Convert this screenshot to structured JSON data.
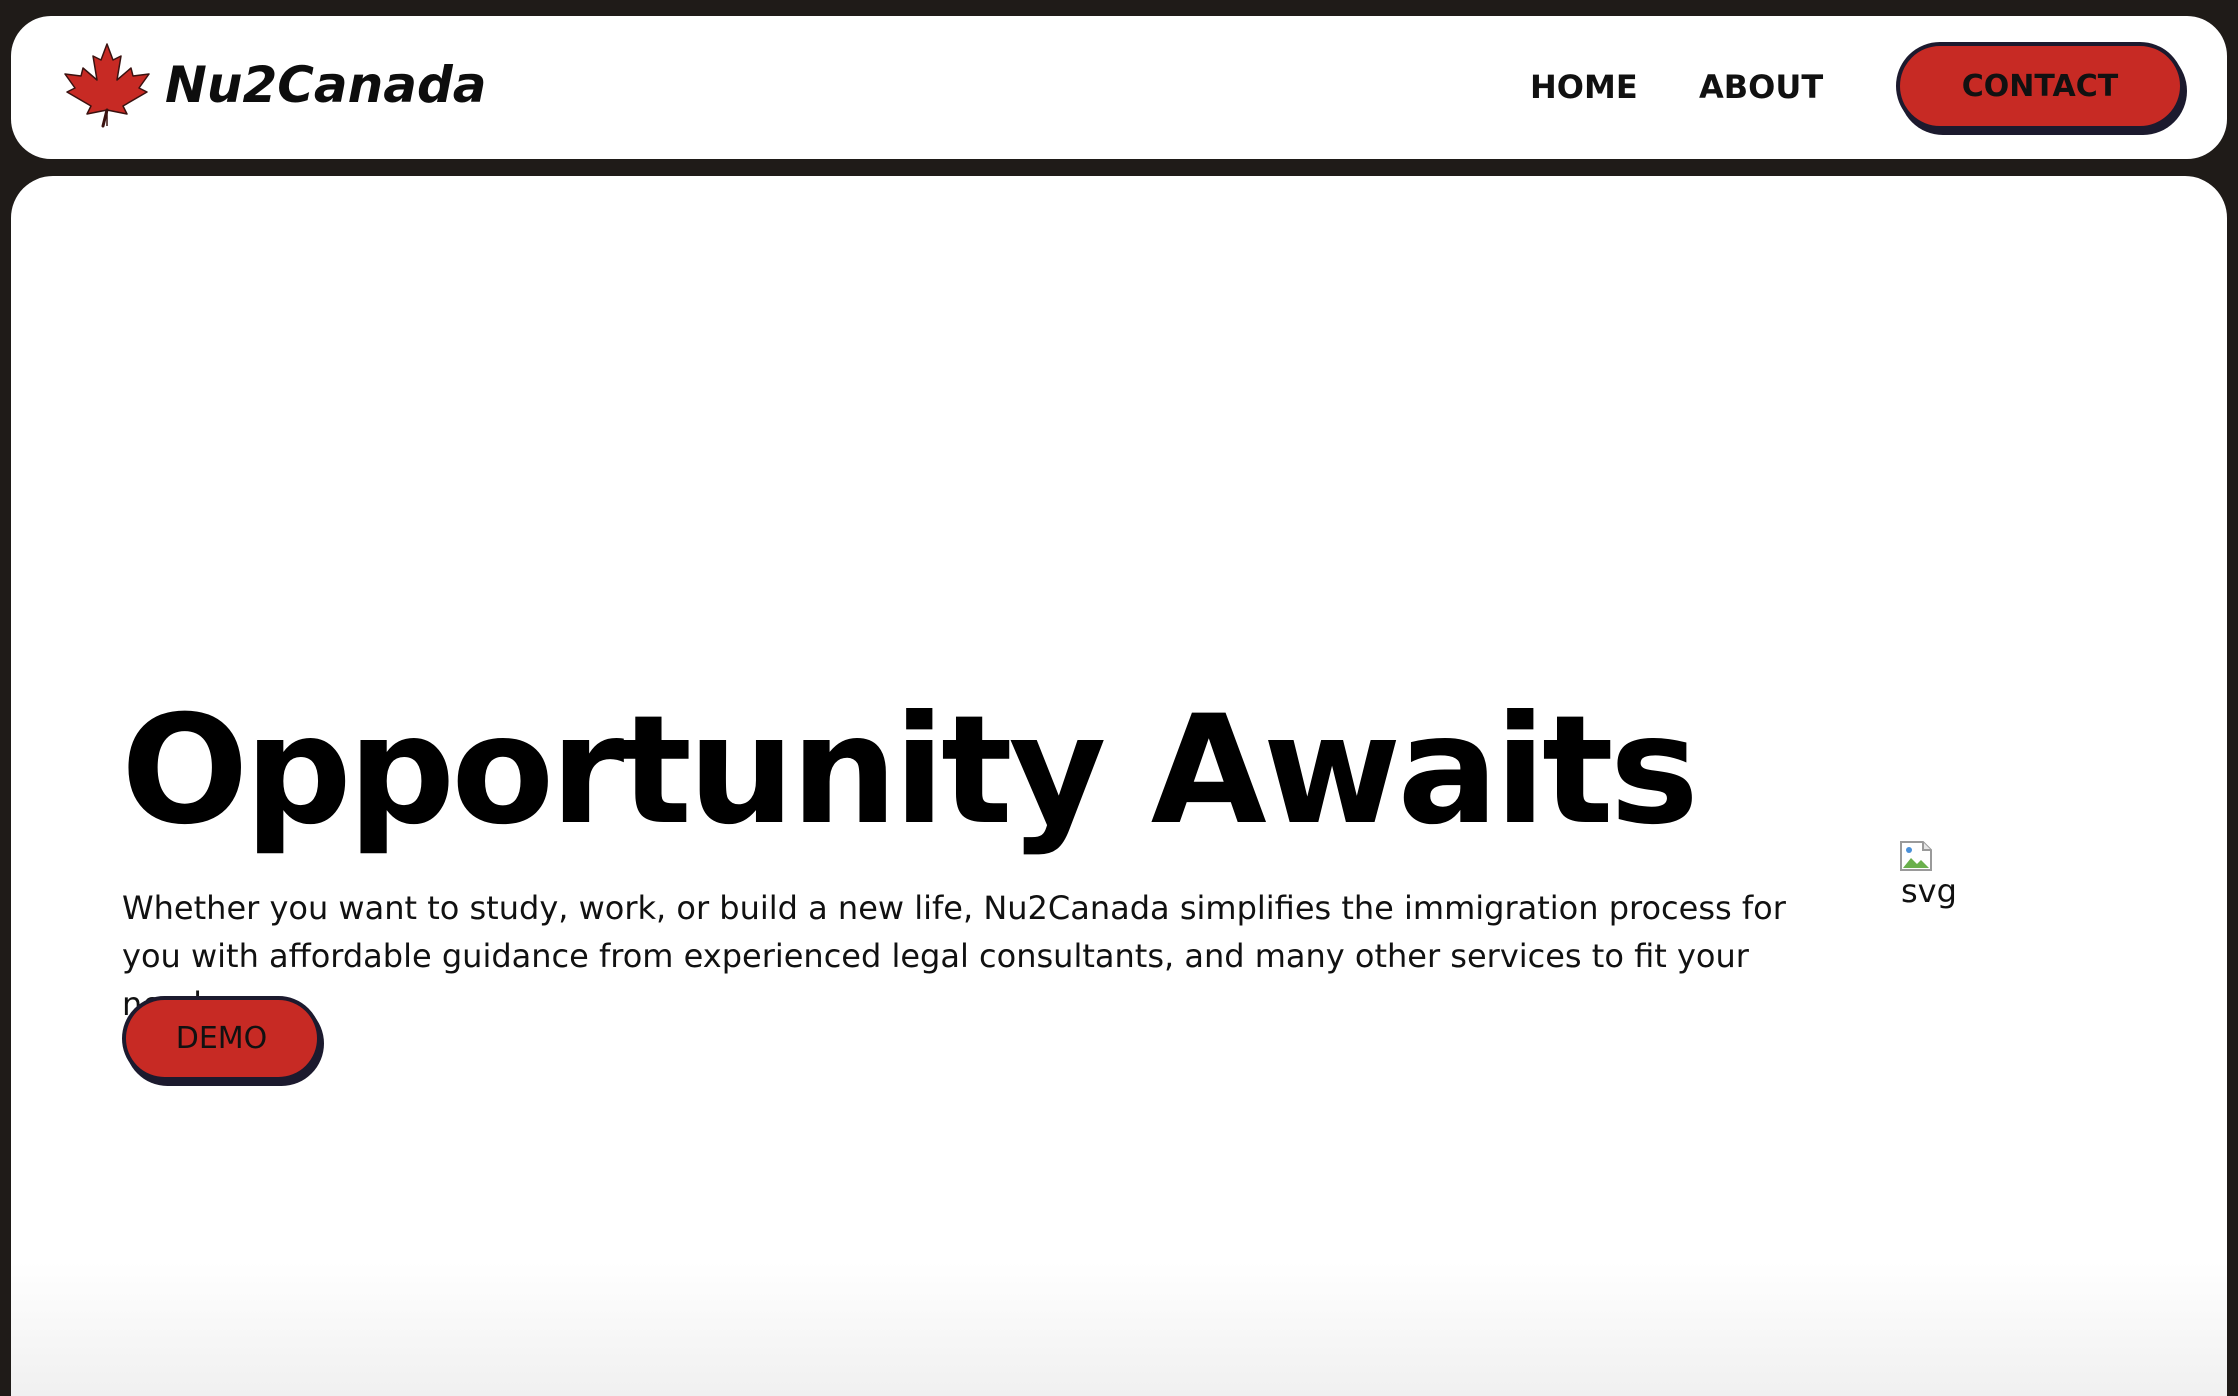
{
  "header": {
    "brand_name": "Nu2Canada",
    "brand_icon": "maple-leaf-icon",
    "nav": {
      "home_label": "HOME",
      "about_label": "ABOUT",
      "contact_label": "CONTACT"
    }
  },
  "hero": {
    "title": "Opportunity Awaits",
    "description": "Whether you want to study, work, or build a new life, Nu2Canada simplifies the immigration process for you with affordable guidance from experienced legal consultants, and many other services to fit your needs.",
    "demo_label": "DEMO",
    "image_alt": "svg",
    "image_icon": "broken-image-icon"
  },
  "colors": {
    "brand_red": "#c72a24",
    "frame_dark": "#1f1b18",
    "button_border": "#1c1a2e"
  }
}
